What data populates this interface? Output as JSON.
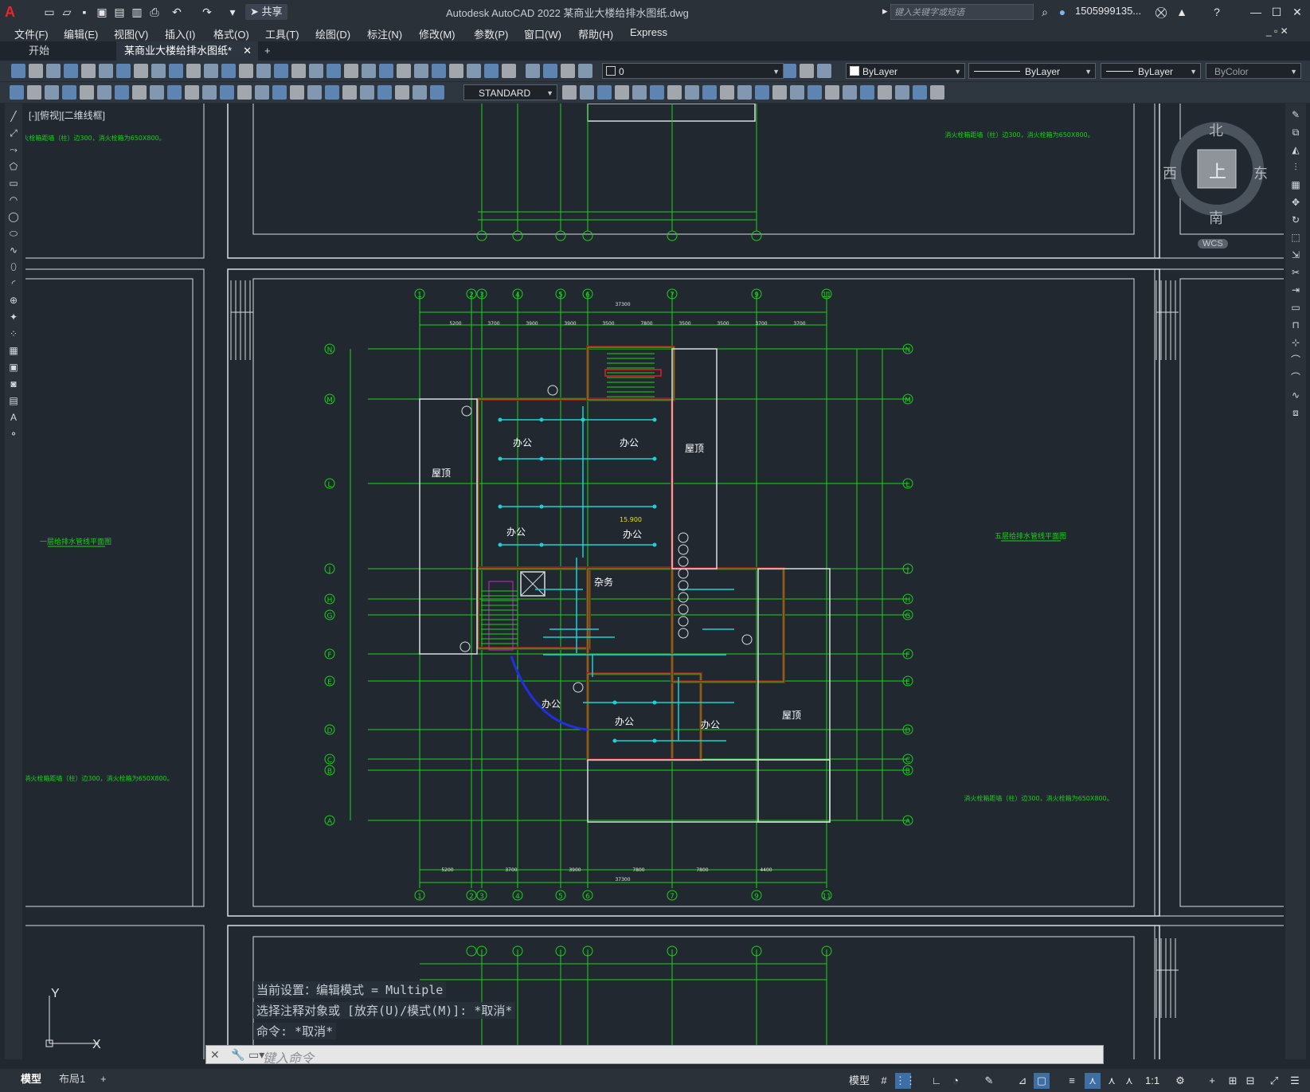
{
  "titlebar": {
    "app_title": "Autodesk AutoCAD 2022    某商业大楼给排水图纸.dwg",
    "share_label": "共享",
    "search_placeholder": "键入关键字或短语",
    "user": "1505999135..."
  },
  "menu": {
    "items": [
      "文件(F)",
      "编辑(E)",
      "视图(V)",
      "插入(I)",
      "格式(O)",
      "工具(T)",
      "绘图(D)",
      "标注(N)",
      "修改(M)",
      "参数(P)",
      "窗口(W)",
      "帮助(H)",
      "Express"
    ]
  },
  "tabs": {
    "start": "开始",
    "active_doc": "某商业大楼给排水图纸*",
    "add": "+"
  },
  "toolbar": {
    "layer_value": "0",
    "color_value": "ByLayer",
    "linetype_value": "ByLayer",
    "lineweight_value": "ByLayer",
    "plotstyle_value": "ByColor",
    "textstyle_value": "STANDARD"
  },
  "viewport": {
    "label": "[-][俯视][二维线框]"
  },
  "viewcube": {
    "north": "北",
    "south": "南",
    "east": "东",
    "west": "西",
    "top": "上",
    "wcs": "WCS"
  },
  "drawing": {
    "room_labels": [
      "办公",
      "办公",
      "办公",
      "办公",
      "杂务",
      "办公",
      "办公",
      "办公"
    ],
    "roof_labels": [
      "屋顶",
      "屋顶",
      "屋顶"
    ],
    "elevation": "15.900",
    "left_title": "一层给排水管线平面图",
    "right_title": "五层给排水管线平面图",
    "note": "消火栓箱距墙（柱）边300，消火栓箱为650X800。",
    "grid_top": [
      "1",
      "2",
      "3",
      "4",
      "5",
      "6",
      "7",
      "9",
      "11"
    ],
    "grid_side": [
      "N",
      "M",
      "L",
      "J",
      "H",
      "G",
      "F",
      "E",
      "D",
      "C",
      "B",
      "A"
    ],
    "dim_total_top": "37300",
    "dim_total_bottom": "37300",
    "dim_top": [
      "5200",
      "3700",
      "3900",
      "3900",
      "3500",
      "7800",
      "3500",
      "3500",
      "3700",
      "3700"
    ],
    "dim_bottom": [
      "5200",
      "3700",
      "3900",
      "7800",
      "7800",
      "4400"
    ]
  },
  "command": {
    "history": [
      "当前设置：编辑模式 = Multiple",
      "选择注释对象或 [放弃(U)/模式(M)]: *取消*",
      "命令: *取消*"
    ],
    "placeholder": "键入命令"
  },
  "statusbar": {
    "model_tab": "模型",
    "layout_tab": "布局1",
    "add": "+",
    "model_label": "模型",
    "scale": "1:1"
  },
  "colors": {
    "background": "#212830",
    "grid": "#19d319",
    "pipe": "#1bd0d8",
    "wall": "#8b1f1f",
    "frame": "#d9dde2"
  }
}
